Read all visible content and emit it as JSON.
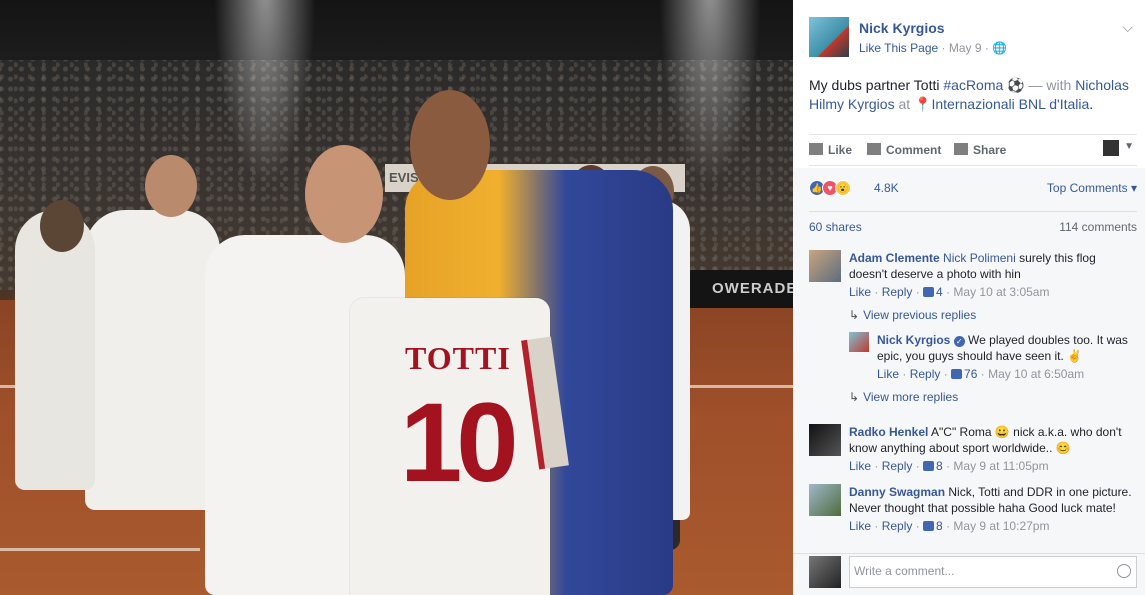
{
  "photo": {
    "jersey_name": "TOTTI",
    "jersey_number": "10",
    "banner_text": "OWERADE",
    "board_text": "EVISSI"
  },
  "post": {
    "page_name": "Nick Kyrgios",
    "like_page": "Like This Page",
    "separator": "·",
    "date": "May 9",
    "privacy_icon": "globe-icon",
    "caption_text": "My dubs partner Totti ",
    "caption_hashtag": "#acRoma",
    "caption_emoji": "⚽",
    "caption_with": " — with ",
    "caption_tagged": "Nicholas Hilmy Kyrgios",
    "caption_at": " at ",
    "caption_location_icon": "map-pin-icon",
    "caption_location": "Internazionali BNL d'Italia",
    "caption_end": "."
  },
  "actions": {
    "like": "Like",
    "comment": "Comment",
    "share": "Share"
  },
  "feedback": {
    "reaction_count": "4.8K",
    "top_comments": "Top Comments",
    "shares": "60 shares",
    "comments": "114 comments"
  },
  "comments": [
    {
      "author": "Adam Clemente",
      "tag": "Nick Polimeni",
      "text": " surely this flog doesn't deserve a photo with hin",
      "like": "Like",
      "reply": "Reply",
      "likes": "4",
      "time": "May 10 at 3:05am"
    },
    {
      "author": "Radko Henkel",
      "text": "A\"C\" Roma 😀 nick a.k.a. who don't know anything about sport worldwide.. 😊",
      "like": "Like",
      "reply": "Reply",
      "likes": "8",
      "time": "May 9 at 11:05pm"
    },
    {
      "author": "Danny Swagman",
      "text": "Nick, Totti and DDR in one picture. Never thought that possible haha Good luck mate!",
      "like": "Like",
      "reply": "Reply",
      "likes": "8",
      "time": "May 9 at 10:27pm"
    }
  ],
  "replies": {
    "previous": "View previous replies",
    "more": "View more replies",
    "items": [
      {
        "author": "Nick Kyrgios",
        "text": "We played doubles too. It was epic, you guys should have seen it. ✌",
        "like": "Like",
        "reply": "Reply",
        "likes": "76",
        "time": "May 10 at 6:50am"
      }
    ]
  },
  "compose": {
    "placeholder": "Write a comment..."
  },
  "colors": {
    "link": "#365899",
    "muted": "#90949c",
    "panel_bg": "#f6f7f9"
  }
}
